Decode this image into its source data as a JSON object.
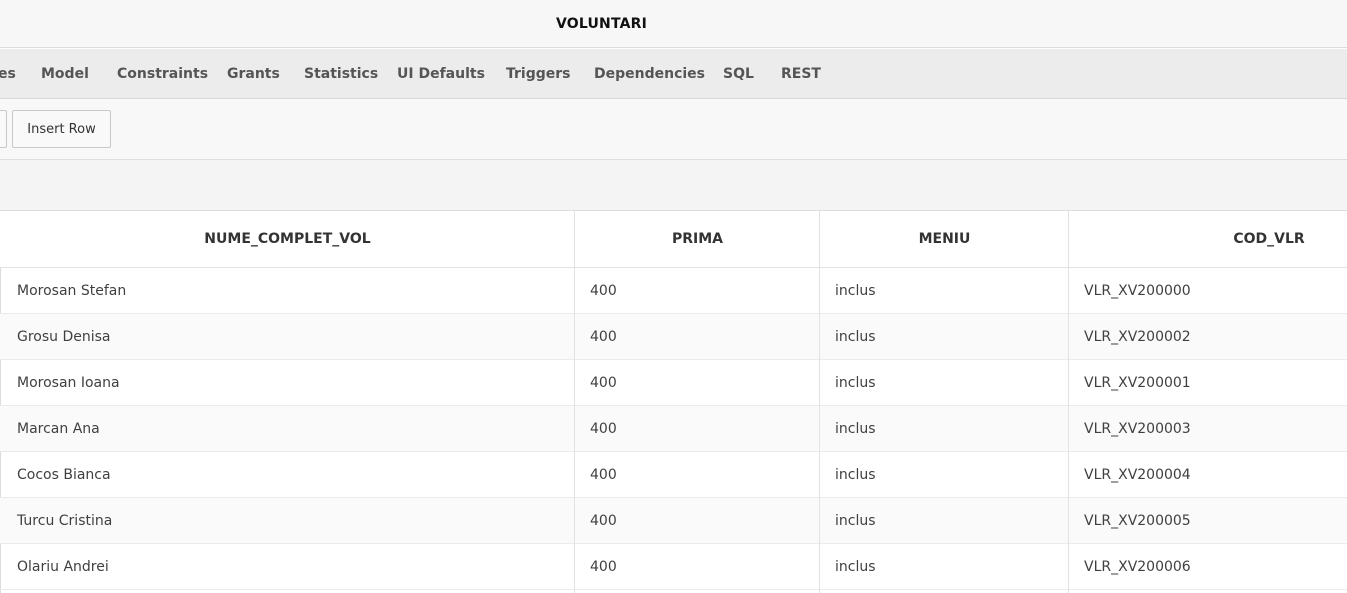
{
  "window": {
    "title": "VOLUNTARI"
  },
  "tabs": [
    {
      "label": "es"
    },
    {
      "label": "Model"
    },
    {
      "label": "Constraints"
    },
    {
      "label": "Grants"
    },
    {
      "label": "Statistics"
    },
    {
      "label": "UI Defaults"
    },
    {
      "label": "Triggers"
    },
    {
      "label": "Dependencies"
    },
    {
      "label": "SQL"
    },
    {
      "label": "REST"
    }
  ],
  "toolbar": {
    "insert_row_label": "Insert Row"
  },
  "table": {
    "columns": [
      "NUME_COMPLET_VOL",
      "PRIMA",
      "MENIU",
      "COD_VLR"
    ],
    "rows": [
      [
        "Morosan Stefan",
        "400",
        "inclus",
        "VLR_XV200000"
      ],
      [
        "Grosu Denisa",
        "400",
        "inclus",
        "VLR_XV200002"
      ],
      [
        "Morosan Ioana",
        "400",
        "inclus",
        "VLR_XV200001"
      ],
      [
        "Marcan Ana",
        "400",
        "inclus",
        "VLR_XV200003"
      ],
      [
        "Cocos Bianca",
        "400",
        "inclus",
        "VLR_XV200004"
      ],
      [
        "Turcu Cristina",
        "400",
        "inclus",
        "VLR_XV200005"
      ],
      [
        "Olariu Andrei",
        "400",
        "inclus",
        "VLR_XV200006"
      ]
    ]
  }
}
